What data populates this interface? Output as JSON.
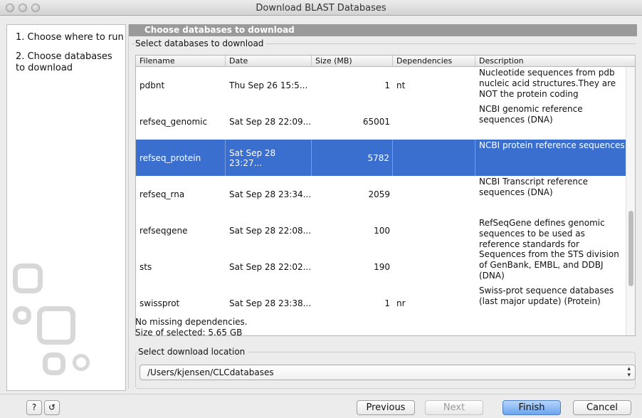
{
  "window": {
    "title": "Download BLAST Databases"
  },
  "steps": [
    {
      "label": "1. Choose where to run"
    },
    {
      "label": "2. Choose databases to download"
    }
  ],
  "main": {
    "header": "Choose databases to download",
    "group_title": "Select databases to download",
    "columns": [
      "Filename",
      "Date",
      "Size (MB)",
      "Dependencies",
      "Description"
    ],
    "rows": [
      {
        "filename": "pdbnt",
        "date": "Thu Sep 26 15:5...",
        "size": "1",
        "dependencies": "nt",
        "description": "Nucleotide sequences from pdb nucleic acid structures.They are NOT the protein coding",
        "selected": false
      },
      {
        "filename": "refseq_genomic",
        "date": "Sat Sep 28 22:09...",
        "size": "65001",
        "dependencies": "",
        "description": "NCBI genomic reference sequences (DNA)",
        "selected": false
      },
      {
        "filename": "refseq_protein",
        "date": "Sat Sep 28 23:27...",
        "size": "5782",
        "dependencies": "",
        "description": "NCBI protein reference sequences",
        "selected": true
      },
      {
        "filename": "refseq_rna",
        "date": "Sat Sep 28 23:34...",
        "size": "2059",
        "dependencies": "",
        "description": "NCBI Transcript reference sequences (DNA)",
        "selected": false
      },
      {
        "filename": "refseqgene",
        "date": "Sat Sep 28 22:08...",
        "size": "100",
        "dependencies": "",
        "description": "RefSeqGene defines genomic sequences to be used as reference standards for",
        "selected": false
      },
      {
        "filename": "sts",
        "date": "Sat Sep 28 22:02...",
        "size": "190",
        "dependencies": "",
        "description": "Sequences from the STS division of GenBank, EMBL, and DDBJ (DNA)",
        "selected": false
      },
      {
        "filename": "swissprot",
        "date": "Sat Sep 28 23:38...",
        "size": "1",
        "dependencies": "nr",
        "description": "Swiss-prot sequence databases (last major update) (Protein)",
        "selected": false
      }
    ],
    "status_dependencies": "No missing dependencies.",
    "status_size": "Size of selected: 5.65 GB",
    "location_title": "Select download location",
    "location_value": "/Users/kjensen/CLCdatabases"
  },
  "footer": {
    "help_icon": "?",
    "help_icon_name": "help-icon",
    "reset_icon_name": "reset-icon",
    "previous": "Previous",
    "next": "Next",
    "finish": "Finish",
    "cancel": "Cancel"
  }
}
